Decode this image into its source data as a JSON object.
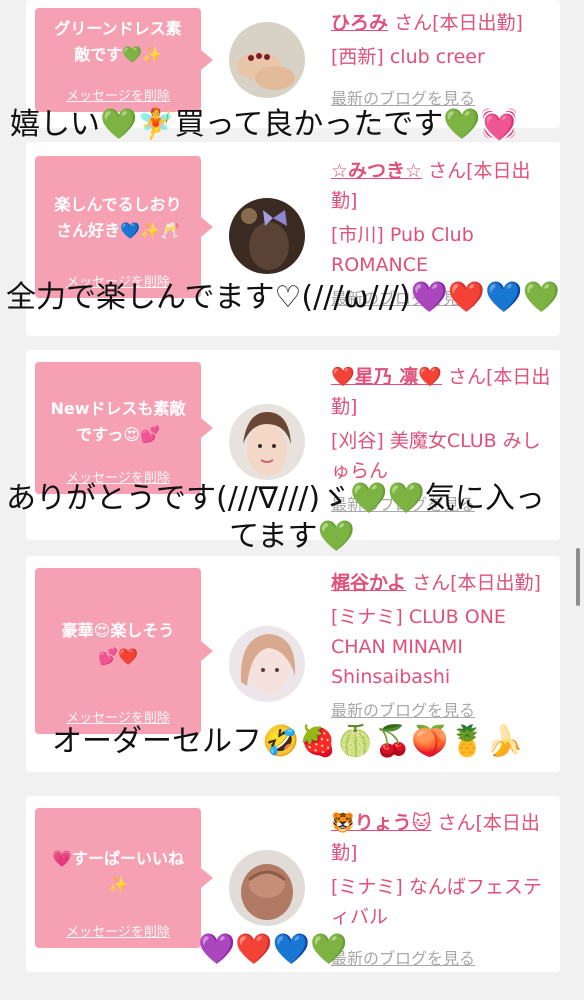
{
  "cards": [
    {
      "message": "グリーンドレス素\n敵です💚✨",
      "delete_label": "メッセージを削除",
      "name": "ひろみ",
      "suffix": "さん[本日出勤]",
      "shop": "[西新] club creer",
      "blog_label": "最新のブログを見る"
    },
    {
      "message": "楽しんでるしおり\nさん好き💙✨🥂",
      "delete_label": "メッセージを削除",
      "name": "☆みつき☆",
      "suffix": "さん[本日出勤]",
      "shop": "[市川] Pub Club ROMANCE",
      "blog_label": "最新のブログを見る"
    },
    {
      "message": "Newドレスも素敵\nですっ😍💕",
      "delete_label": "メッセージを削除",
      "name": "❤️星乃 凛❤️",
      "suffix": "さん[本日出勤]",
      "shop": "[刈谷] 美魔女CLUB みしゅらん",
      "blog_label": "最新のブログを見る"
    },
    {
      "message": "豪華😍楽しそう\n💕❤️",
      "delete_label": "メッセージを削除",
      "name": "梶谷かよ",
      "suffix": "さん[本日出勤]",
      "shop": "[ミナミ] CLUB ONE CHAN MINAMI Shinsaibashi",
      "blog_label": "最新のブログを見る"
    },
    {
      "message": "💗すーぱーいいね\n✨",
      "delete_label": "メッセージを削除",
      "name": "🐯りょう🐱",
      "suffix": "さん[本日出勤]",
      "shop": "[ミナミ] なんばフェスティバル",
      "blog_label": "最新のブログを見る"
    }
  ],
  "captions": [
    "嬉しい💚🧚買って良かったです💚💓",
    "全力で楽しんでます♡(///ω///)💜❤️💙💚",
    "ありがとうです(///∇///)ゞ💚💚気に入っ",
    "てます💚",
    "オーダーセルフ🤣🍓🍈🍒🍑🍍🍌",
    "💜❤️💙💚"
  ],
  "colors": {
    "bubble": "#f6a1b3",
    "name": "#e0507a",
    "muted": "#a8a8a8",
    "background": "#f1f1f1"
  }
}
